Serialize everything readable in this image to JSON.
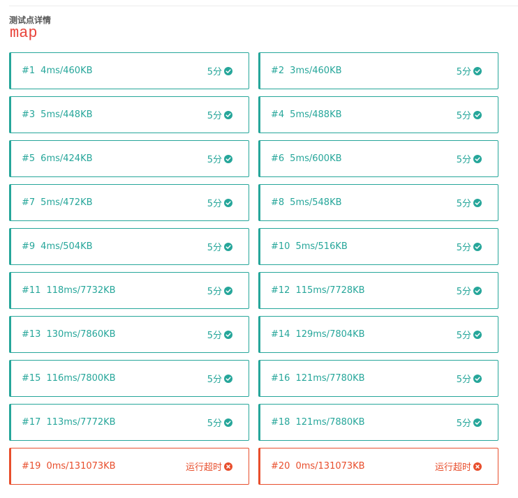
{
  "header": {
    "section_title": "测试点详情",
    "case_name": "map"
  },
  "colors": {
    "accepted": "#26a69a",
    "time_limit_exceeded": "#e84e2c",
    "case_name": "#e8453c"
  },
  "icons": {
    "accepted": "check-circle-icon",
    "time_limit_exceeded": "close-circle-icon"
  },
  "testcases": [
    {
      "id": "#1",
      "stats": "4ms/460KB",
      "verdict": "5分",
      "status": "accepted"
    },
    {
      "id": "#2",
      "stats": "3ms/460KB",
      "verdict": "5分",
      "status": "accepted"
    },
    {
      "id": "#3",
      "stats": "5ms/448KB",
      "verdict": "5分",
      "status": "accepted"
    },
    {
      "id": "#4",
      "stats": "5ms/488KB",
      "verdict": "5分",
      "status": "accepted"
    },
    {
      "id": "#5",
      "stats": "6ms/424KB",
      "verdict": "5分",
      "status": "accepted"
    },
    {
      "id": "#6",
      "stats": "5ms/600KB",
      "verdict": "5分",
      "status": "accepted"
    },
    {
      "id": "#7",
      "stats": "5ms/472KB",
      "verdict": "5分",
      "status": "accepted"
    },
    {
      "id": "#8",
      "stats": "5ms/548KB",
      "verdict": "5分",
      "status": "accepted"
    },
    {
      "id": "#9",
      "stats": "4ms/504KB",
      "verdict": "5分",
      "status": "accepted"
    },
    {
      "id": "#10",
      "stats": "5ms/516KB",
      "verdict": "5分",
      "status": "accepted"
    },
    {
      "id": "#11",
      "stats": "118ms/7732KB",
      "verdict": "5分",
      "status": "accepted"
    },
    {
      "id": "#12",
      "stats": "115ms/7728KB",
      "verdict": "5分",
      "status": "accepted"
    },
    {
      "id": "#13",
      "stats": "130ms/7860KB",
      "verdict": "5分",
      "status": "accepted"
    },
    {
      "id": "#14",
      "stats": "129ms/7804KB",
      "verdict": "5分",
      "status": "accepted"
    },
    {
      "id": "#15",
      "stats": "116ms/7800KB",
      "verdict": "5分",
      "status": "accepted"
    },
    {
      "id": "#16",
      "stats": "121ms/7780KB",
      "verdict": "5分",
      "status": "accepted"
    },
    {
      "id": "#17",
      "stats": "113ms/7772KB",
      "verdict": "5分",
      "status": "accepted"
    },
    {
      "id": "#18",
      "stats": "121ms/7880KB",
      "verdict": "5分",
      "status": "accepted"
    },
    {
      "id": "#19",
      "stats": "0ms/131073KB",
      "verdict": "运行超时",
      "status": "time_limit_exceeded"
    },
    {
      "id": "#20",
      "stats": "0ms/131073KB",
      "verdict": "运行超时",
      "status": "time_limit_exceeded"
    }
  ]
}
